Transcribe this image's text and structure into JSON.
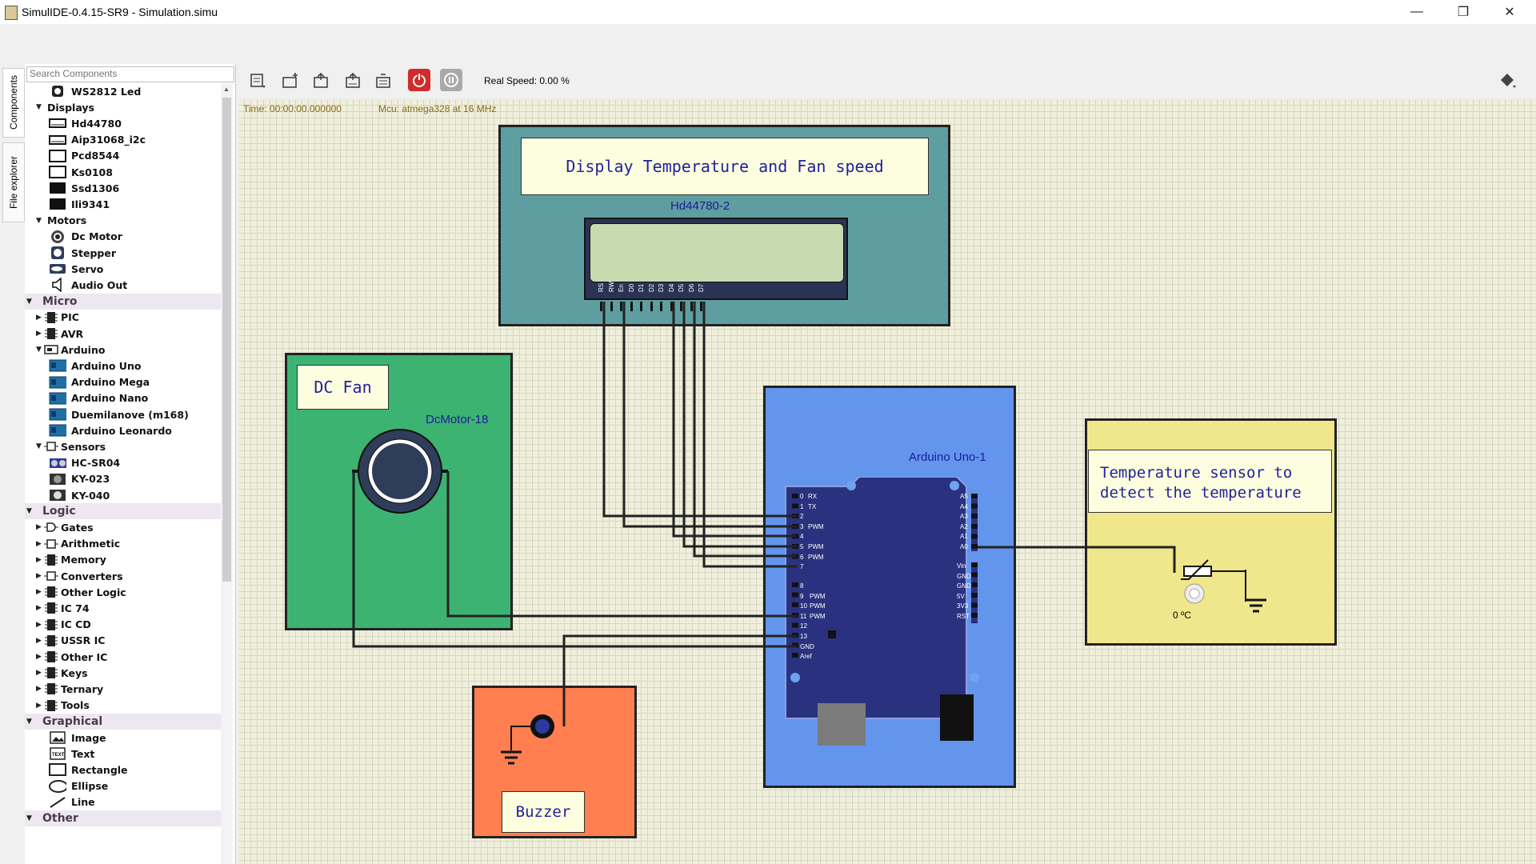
{
  "window": {
    "title": "SimulIDE-0.4.15-SR9  -  Simulation.simu",
    "minimize": "—",
    "restore": "❐",
    "close": "✕"
  },
  "left_tabs": [
    "Components",
    "File explorer"
  ],
  "search": {
    "placeholder": "Search Components"
  },
  "tree": [
    {
      "label": "WS2812 Led",
      "kind": "item",
      "icon": "led-icon"
    },
    {
      "label": "Displays",
      "kind": "group",
      "expanded": true
    },
    {
      "label": "Hd44780",
      "kind": "item",
      "icon": "lcd-icon"
    },
    {
      "label": "Aip31068_i2c",
      "kind": "item",
      "icon": "lcd-icon"
    },
    {
      "label": "Pcd8544",
      "kind": "item",
      "icon": "display-icon"
    },
    {
      "label": "Ks0108",
      "kind": "item",
      "icon": "display-icon"
    },
    {
      "label": "Ssd1306",
      "kind": "item",
      "icon": "oled-icon"
    },
    {
      "label": "Ili9341",
      "kind": "item",
      "icon": "oled-icon"
    },
    {
      "label": "Motors",
      "kind": "group",
      "expanded": true
    },
    {
      "label": "Dc Motor",
      "kind": "item",
      "icon": "motor-icon"
    },
    {
      "label": "Stepper",
      "kind": "item",
      "icon": "stepper-icon"
    },
    {
      "label": "Servo",
      "kind": "item",
      "icon": "servo-icon"
    },
    {
      "label": "Audio Out",
      "kind": "item",
      "icon": "speaker-icon"
    },
    {
      "label": "Micro",
      "kind": "category",
      "expanded": true
    },
    {
      "label": "PIC",
      "kind": "subgroup",
      "expanded": false
    },
    {
      "label": "AVR",
      "kind": "subgroup",
      "expanded": false
    },
    {
      "label": "Arduino",
      "kind": "subgroup",
      "expanded": true
    },
    {
      "label": "Arduino Uno",
      "kind": "item",
      "icon": "arduino-board-icon"
    },
    {
      "label": "Arduino Mega",
      "kind": "item",
      "icon": "arduino-board-icon"
    },
    {
      "label": "Arduino Nano",
      "kind": "item",
      "icon": "arduino-board-icon"
    },
    {
      "label": "Duemilanove (m168)",
      "kind": "item",
      "icon": "arduino-board-icon"
    },
    {
      "label": "Arduino Leonardo",
      "kind": "item",
      "icon": "arduino-board-icon"
    },
    {
      "label": "Sensors",
      "kind": "subgroup",
      "expanded": true
    },
    {
      "label": "HC-SR04",
      "kind": "item",
      "icon": "ultrasonic-icon"
    },
    {
      "label": "KY-023",
      "kind": "item",
      "icon": "joystick-icon"
    },
    {
      "label": "KY-040",
      "kind": "item",
      "icon": "encoder-icon"
    },
    {
      "label": "Logic",
      "kind": "category",
      "expanded": true
    },
    {
      "label": "Gates",
      "kind": "subgroup",
      "expanded": false
    },
    {
      "label": "Arithmetic",
      "kind": "subgroup",
      "expanded": false
    },
    {
      "label": "Memory",
      "kind": "subgroup",
      "expanded": false
    },
    {
      "label": "Converters",
      "kind": "subgroup",
      "expanded": false
    },
    {
      "label": "Other Logic",
      "kind": "subgroup",
      "expanded": false
    },
    {
      "label": "IC 74",
      "kind": "subgroup",
      "expanded": false
    },
    {
      "label": "IC CD",
      "kind": "subgroup",
      "expanded": false
    },
    {
      "label": "USSR IC",
      "kind": "subgroup",
      "expanded": false
    },
    {
      "label": "Other IC",
      "kind": "subgroup",
      "expanded": false
    },
    {
      "label": "Keys",
      "kind": "subgroup",
      "expanded": false
    },
    {
      "label": "Ternary",
      "kind": "subgroup",
      "expanded": false
    },
    {
      "label": "Tools",
      "kind": "subgroup",
      "expanded": false
    },
    {
      "label": "Graphical",
      "kind": "category",
      "expanded": true
    },
    {
      "label": "Image",
      "kind": "item",
      "icon": "image-icon"
    },
    {
      "label": "Text",
      "kind": "item",
      "icon": "text-icon"
    },
    {
      "label": "Rectangle",
      "kind": "item",
      "icon": "rectangle-icon"
    },
    {
      "label": "Ellipse",
      "kind": "item",
      "icon": "ellipse-icon"
    },
    {
      "label": "Line",
      "kind": "item",
      "icon": "line-icon"
    },
    {
      "label": "Other",
      "kind": "category",
      "expanded": true
    }
  ],
  "toolbar": {
    "buttons": [
      "new-circuit",
      "open-circuit",
      "save-circuit",
      "save-as",
      "export",
      "power",
      "pause"
    ],
    "real_speed": "Real Speed: 0.00 %",
    "info_icon": "info-diamond-icon"
  },
  "status": {
    "time": "Time: 00:00:00.000000",
    "mcu": "Mcu: atmega328 at 16 MHz"
  },
  "circuit": {
    "lcd_note": "Display Temperature and Fan speed",
    "lcd_label": "Hd44780-2",
    "lcd_pins": [
      "RS",
      "RW",
      "En",
      "D0",
      "D1",
      "D2",
      "D3",
      "D4",
      "D5",
      "D6",
      "D7"
    ],
    "fan_note": "DC Fan",
    "motor_label": "DcMotor-18",
    "arduino_label": "Arduino Uno-1",
    "arduino_left_pins_top": [
      "0",
      "RX",
      "1",
      "TX",
      "2",
      "3",
      "PWM",
      "4",
      "5",
      "PWM",
      "6",
      "PWM",
      "7"
    ],
    "arduino_left_pins_bottom": [
      "8",
      "9",
      "PWM",
      "10",
      "PWM",
      "11",
      "PWM",
      "12",
      "13",
      "GND",
      "Aref"
    ],
    "arduino_right_pins_top": [
      "A5",
      "A4",
      "A3",
      "A2",
      "A1",
      "A0"
    ],
    "arduino_right_pins_bottom": [
      "Vin",
      "GND",
      "GND",
      "5V",
      "3V3",
      "RST"
    ],
    "sensor_note_line1": "Temperature sensor to",
    "sensor_note_line2": "detect the temperature",
    "sensor_value": "0 ºC",
    "buzzer_note": "Buzzer",
    "colors": {
      "lcd_panel": "#5f9ea0",
      "fan_panel": "#3cb371",
      "arduino_panel": "#6495ed",
      "sensor_panel": "#f0e68c",
      "buzzer_panel": "#ff7f50",
      "board": "#2a3280"
    }
  }
}
